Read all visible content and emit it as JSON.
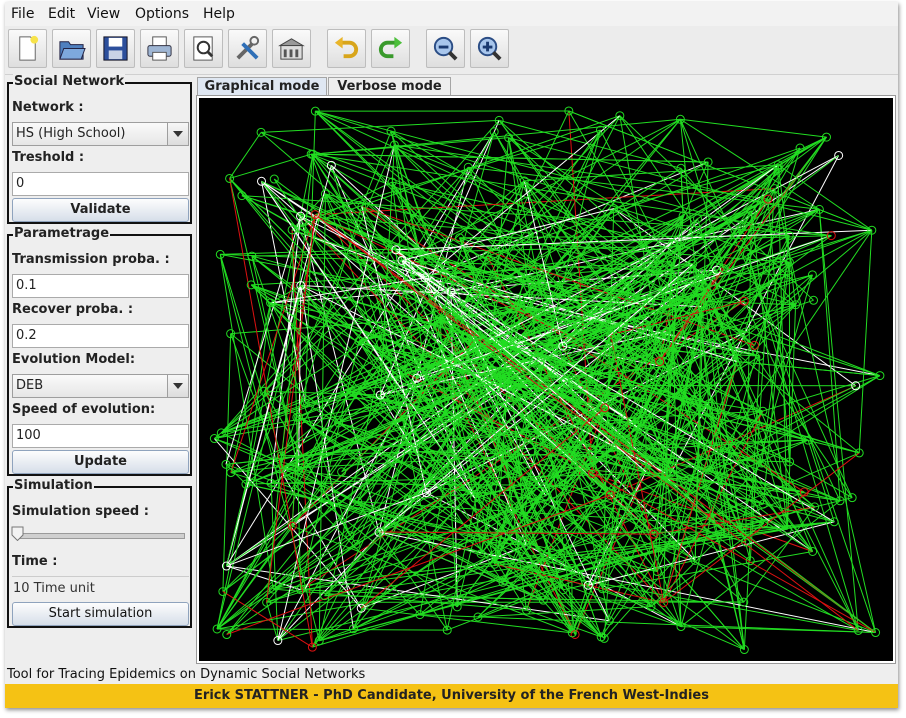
{
  "menubar": {
    "items": [
      "File",
      "Edit",
      "View",
      "Options",
      "Help"
    ]
  },
  "toolbar": {
    "buttons": [
      "new-file-icon",
      "open-folder-icon",
      "save-icon",
      "print-icon",
      "print-preview-icon",
      "tools-icon",
      "statistics-icon",
      "undo-icon",
      "redo-icon",
      "zoom-out-icon",
      "zoom-in-icon"
    ]
  },
  "social_network": {
    "title": "Social Network",
    "network_label": "Network :",
    "network_value": "HS (High School)",
    "threshold_label": "Treshold :",
    "threshold_value": "0",
    "validate_label": "Validate"
  },
  "parametrage": {
    "title": "Parametrage",
    "transmission_label": "Transmission proba. :",
    "transmission_value": "0.1",
    "recover_label": "Recover proba. :",
    "recover_value": "0.2",
    "model_label": "Evolution Model:",
    "model_value": "DEB",
    "speed_label": "Speed of evolution:",
    "speed_value": "100",
    "update_label": "Update"
  },
  "simulation": {
    "title": "Simulation",
    "speed_label": "Simulation speed :",
    "speed_level": 0,
    "time_label": "Time :",
    "time_value": "10 Time unit",
    "start_label": "Start simulation"
  },
  "tabs": [
    {
      "label": "Graphical mode",
      "active": true
    },
    {
      "label": "Verbose mode",
      "active": false
    }
  ],
  "graph": {
    "background": "#000000",
    "edge_colors": {
      "susceptible": "#22dd22",
      "infected": "#dd1111",
      "recovered": "#ffffff"
    }
  },
  "status": {
    "text": "Tool for Tracing Epidemics on Dynamic Social Networks"
  },
  "footer": {
    "text": "Erick STATTNER - PhD Candidate, University of the French West-Indies",
    "color": "#f5c214"
  }
}
